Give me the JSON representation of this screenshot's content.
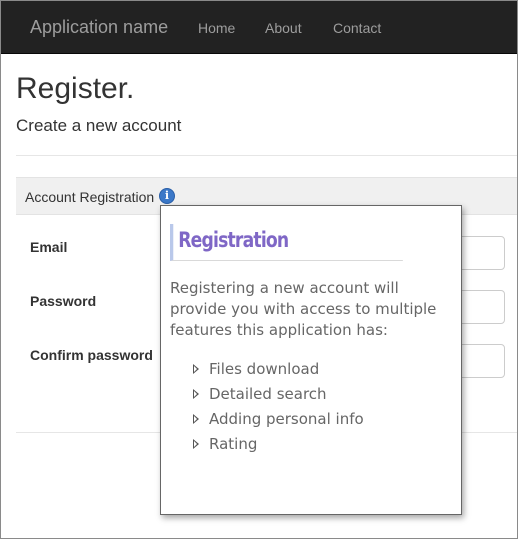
{
  "navbar": {
    "brand": "Application name",
    "links": [
      "Home",
      "About",
      "Contact"
    ]
  },
  "page": {
    "title": "Register.",
    "subtitle": "Create a new account"
  },
  "panel": {
    "title": "Account Registration",
    "info_icon": "info-icon"
  },
  "form": {
    "fields": [
      {
        "label": "Email",
        "value": ""
      },
      {
        "label": "Password",
        "value": ""
      },
      {
        "label": "Confirm password",
        "value": ""
      }
    ]
  },
  "popover": {
    "title": "Registration",
    "body": "Registering a new account will provide you with access to multiple features this application has:",
    "features": [
      "Files download",
      "Detailed search",
      "Adding personal info",
      "Rating"
    ]
  },
  "colors": {
    "navbar_bg": "#222222",
    "nav_text": "#9d9d9d",
    "popover_title": "#7f67c6",
    "info_icon": "#3b78c8"
  }
}
